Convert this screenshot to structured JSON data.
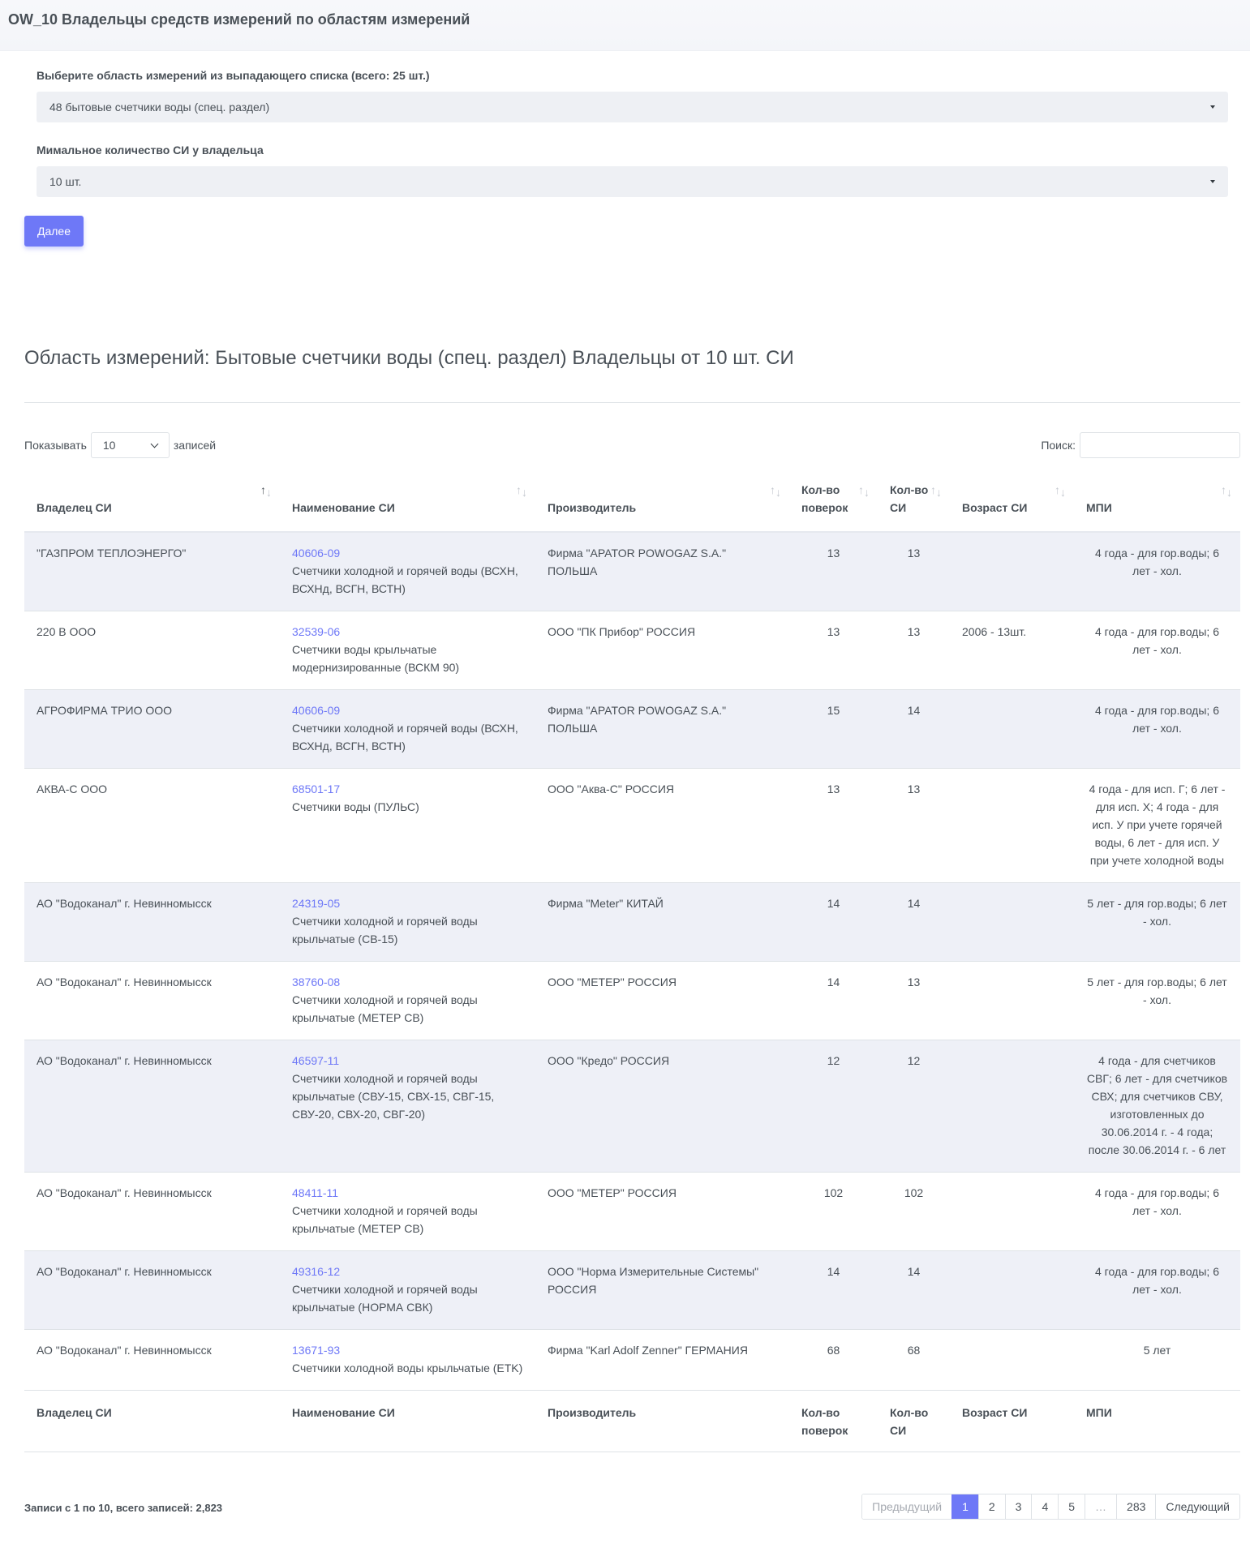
{
  "page_title": "OW_10 Владельцы средств измерений по областям измерений",
  "filters": {
    "area_label": "Выберите область измерений из выпадающего списка (всего: 25 шт.)",
    "area_value": "48 бытовые счетчики воды (спец. раздел)",
    "min_label": "Мимальное количество СИ у владельца",
    "min_value": "10 шт.",
    "next_button": "Далее"
  },
  "result_heading": "Область измерений: Бытовые счетчики воды (спец. раздел) Владельцы от 10 шт. СИ",
  "table_controls": {
    "show_label": "Показывать",
    "length_value": "10",
    "entries_label": "записей",
    "search_label": "Поиск:"
  },
  "columns": {
    "owner": "Владелец СИ",
    "name": "Наименование СИ",
    "maker": "Производитель",
    "checks": "Кол-во поверок",
    "count": "Кол-во СИ",
    "age": "Возраст СИ",
    "mpi": "МПИ"
  },
  "rows": [
    {
      "owner": "\"ГАЗПРОМ ТЕПЛОЭНЕРГО\"",
      "code": "40606-09",
      "name": "Счетчики холодной и горячей воды (ВСХН, ВСХНд, ВСГН, ВСТН)",
      "maker": "Фирма \"APATOR POWOGAZ S.A.\" ПОЛЬША",
      "checks": "13",
      "count": "13",
      "age": "",
      "mpi": "4 года - для гор.воды; 6 лет - хол."
    },
    {
      "owner": "220 В ООО",
      "code": "32539-06",
      "name": "Счетчики воды крыльчатые модернизированные (ВСКМ 90)",
      "maker": "ООО \"ПК Прибор\" РОССИЯ",
      "checks": "13",
      "count": "13",
      "age": "2006 - 13шт.",
      "mpi": "4 года - для гор.воды; 6 лет - хол."
    },
    {
      "owner": "АГРОФИРМА ТРИО ООО",
      "code": "40606-09",
      "name": "Счетчики холодной и горячей воды (ВСХН, ВСХНд, ВСГН, ВСТН)",
      "maker": "Фирма \"APATOR POWOGAZ S.A.\" ПОЛЬША",
      "checks": "15",
      "count": "14",
      "age": "",
      "mpi": "4 года - для гор.воды; 6 лет - хол."
    },
    {
      "owner": "АКВА-С ООО",
      "code": "68501-17",
      "name": "Счетчики воды (ПУЛЬС)",
      "maker": "ООО \"Аква-С\" РОССИЯ",
      "checks": "13",
      "count": "13",
      "age": "",
      "mpi": "4 года - для исп. Г; 6 лет - для исп. Х; 4 года - для исп. У при учете горячей воды, 6 лет - для исп. У при учете холодной воды"
    },
    {
      "owner": "АО \"Водоканал\" г. Невинномысск",
      "code": "24319-05",
      "name": "Счетчики холодной и горячей воды крыльчатые (СВ-15)",
      "maker": "Фирма \"Meter\" КИТАЙ",
      "checks": "14",
      "count": "14",
      "age": "",
      "mpi": "5 лет - для гор.воды; 6 лет - хол."
    },
    {
      "owner": "АО \"Водоканал\" г. Невинномысск",
      "code": "38760-08",
      "name": "Счетчики холодной и горячей воды крыльчатые (МЕТЕР СВ)",
      "maker": "ООО \"МЕТЕР\" РОССИЯ",
      "checks": "14",
      "count": "13",
      "age": "",
      "mpi": "5 лет - для гор.воды; 6 лет - хол."
    },
    {
      "owner": "АО \"Водоканал\" г. Невинномысск",
      "code": "46597-11",
      "name": "Счетчики холодной и горячей воды крыльчатые (СВУ-15, СВХ-15, СВГ-15, СВУ-20, СВХ-20, СВГ-20)",
      "maker": "ООО \"Кредо\" РОССИЯ",
      "checks": "12",
      "count": "12",
      "age": "",
      "mpi": "4 года - для счетчиков СВГ; 6 лет - для счетчиков СВХ; для счетчиков СВУ, изготовленных до 30.06.2014 г. - 4 года; после 30.06.2014 г. - 6 лет"
    },
    {
      "owner": "АО \"Водоканал\" г. Невинномысск",
      "code": "48411-11",
      "name": "Счетчики холодной и горячей воды крыльчатые (МЕТЕР СВ)",
      "maker": "ООО \"МЕТЕР\" РОССИЯ",
      "checks": "102",
      "count": "102",
      "age": "",
      "mpi": "4 года - для гор.воды; 6 лет - хол."
    },
    {
      "owner": "АО \"Водоканал\" г. Невинномысск",
      "code": "49316-12",
      "name": "Счетчики холодной и горячей воды крыльчатые (НОРМА СВК)",
      "maker": "ООО \"Норма Измерительные Системы\" РОССИЯ",
      "checks": "14",
      "count": "14",
      "age": "",
      "mpi": "4 года - для гор.воды; 6 лет - хол."
    },
    {
      "owner": "АО \"Водоканал\" г. Невинномысск",
      "code": "13671-93",
      "name": "Счетчики холодной воды крыльчатые (ETK)",
      "maker": "Фирма \"Karl Adolf Zenner\" ГЕРМАНИЯ",
      "checks": "68",
      "count": "68",
      "age": "",
      "mpi": "5 лет"
    }
  ],
  "footer_info": "Записи с 1 по 10, всего записей: 2,823",
  "pagination": {
    "prev": "Предыдущий",
    "pages": [
      "1",
      "2",
      "3",
      "4",
      "5",
      "…",
      "283"
    ],
    "active": "1",
    "next": "Следующий"
  },
  "colors": {
    "accent": "#6e78f7",
    "stripe": "#eef0f7",
    "text": "#495057"
  }
}
